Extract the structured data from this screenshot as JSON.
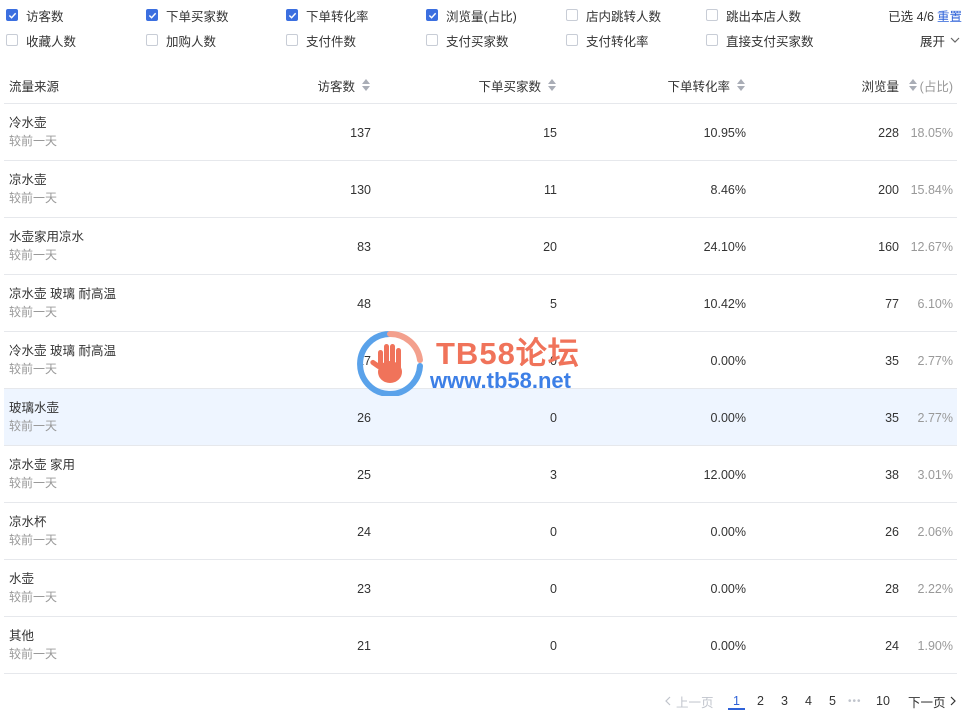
{
  "filters": {
    "row1": [
      {
        "label": "访客数",
        "checked": true
      },
      {
        "label": "下单买家数",
        "checked": true
      },
      {
        "label": "下单转化率",
        "checked": true
      },
      {
        "label": "浏览量(占比)",
        "checked": true
      },
      {
        "label": "店内跳转人数",
        "checked": false
      },
      {
        "label": "跳出本店人数",
        "checked": false
      }
    ],
    "row2": [
      {
        "label": "收藏人数",
        "checked": false
      },
      {
        "label": "加购人数",
        "checked": false
      },
      {
        "label": "支付件数",
        "checked": false
      },
      {
        "label": "支付买家数",
        "checked": false
      },
      {
        "label": "支付转化率",
        "checked": false
      },
      {
        "label": "直接支付买家数",
        "checked": false
      }
    ],
    "selected_count": "已选 4/6",
    "reset_label": "重置",
    "expand_label": "展开"
  },
  "table": {
    "headers": {
      "source": "流量来源",
      "visitors": "访客数",
      "buyers": "下单买家数",
      "conversion": "下单转化率",
      "pageviews": "浏览量",
      "share": "(占比)"
    },
    "compare_label": "较前一天",
    "rows": [
      {
        "source": "冷水壶",
        "visitors": "137",
        "buyers": "15",
        "conversion": "10.95%",
        "pageviews": "228",
        "share": "18.05%"
      },
      {
        "source": "凉水壶",
        "visitors": "130",
        "buyers": "11",
        "conversion": "8.46%",
        "pageviews": "200",
        "share": "15.84%"
      },
      {
        "source": "水壶家用凉水",
        "visitors": "83",
        "buyers": "20",
        "conversion": "24.10%",
        "pageviews": "160",
        "share": "12.67%"
      },
      {
        "source": "凉水壶 玻璃 耐高温",
        "visitors": "48",
        "buyers": "5",
        "conversion": "10.42%",
        "pageviews": "77",
        "share": "6.10%"
      },
      {
        "source": "冷水壶 玻璃 耐高温",
        "visitors": "27",
        "buyers": "0",
        "conversion": "0.00%",
        "pageviews": "35",
        "share": "2.77%"
      },
      {
        "source": "玻璃水壶",
        "visitors": "26",
        "buyers": "0",
        "conversion": "0.00%",
        "pageviews": "35",
        "share": "2.77%"
      },
      {
        "source": "凉水壶 家用",
        "visitors": "25",
        "buyers": "3",
        "conversion": "12.00%",
        "pageviews": "38",
        "share": "3.01%"
      },
      {
        "source": "凉水杯",
        "visitors": "24",
        "buyers": "0",
        "conversion": "0.00%",
        "pageviews": "26",
        "share": "2.06%"
      },
      {
        "source": "水壶",
        "visitors": "23",
        "buyers": "0",
        "conversion": "0.00%",
        "pageviews": "28",
        "share": "2.22%"
      },
      {
        "source": "其他",
        "visitors": "21",
        "buyers": "0",
        "conversion": "0.00%",
        "pageviews": "24",
        "share": "1.90%"
      }
    ],
    "highlighted_row": 5
  },
  "pagination": {
    "prev_label": "上一页",
    "next_label": "下一页",
    "pages": [
      "1",
      "2",
      "3",
      "4",
      "5"
    ],
    "ellipsis": "•••",
    "last_page": "10",
    "current": "1"
  },
  "watermark": {
    "title": "TB58论坛",
    "url": "www.tb58.net"
  },
  "colors": {
    "accent": "#3b6fe0",
    "link": "#2f62d8",
    "highlight_row": "#eef5ff",
    "watermark_red": "#f0735a",
    "watermark_blue": "#3d7fe6"
  }
}
